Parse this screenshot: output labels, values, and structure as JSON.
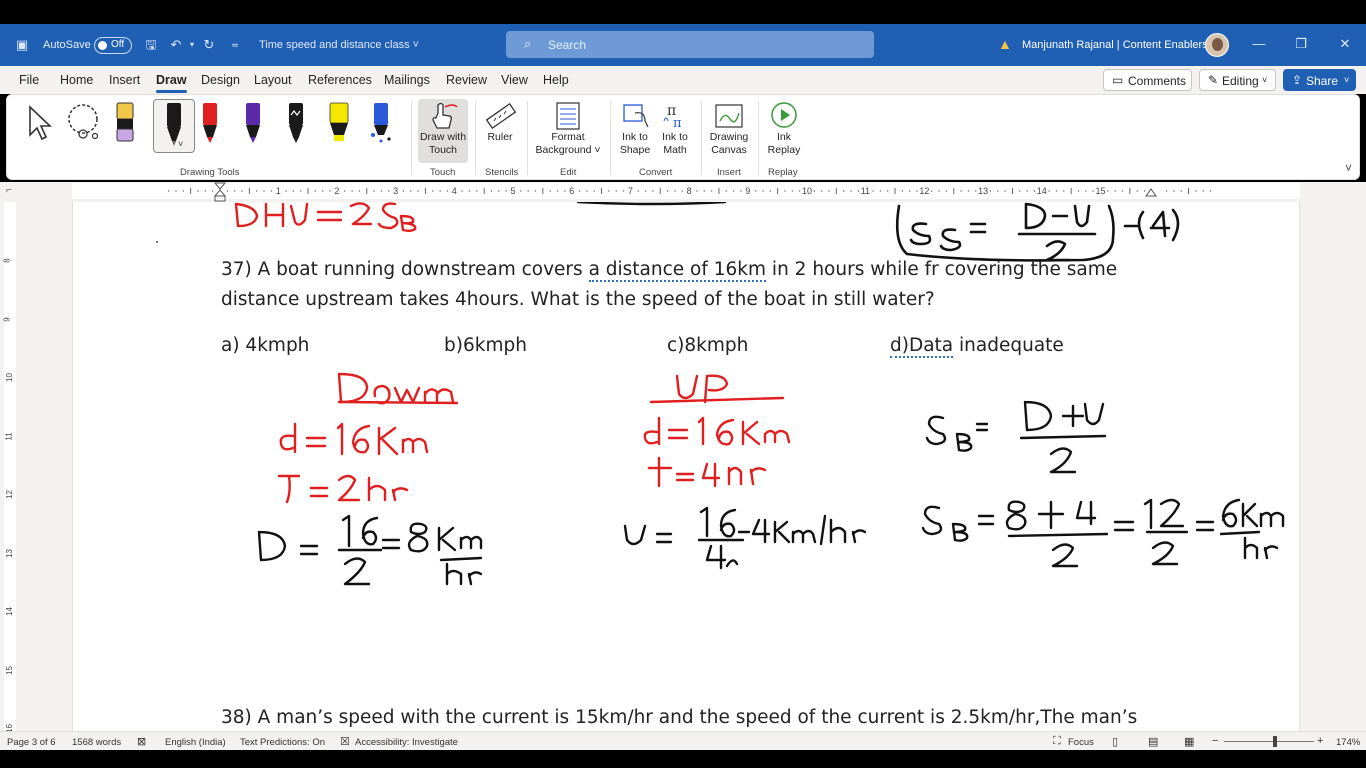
{
  "titlebar": {
    "autosave_label": "AutoSave",
    "autosave_state": "Off",
    "document_title": "Time speed and distance class",
    "search_placeholder": "Search",
    "user_name": "Manjunath Rajanal | Content Enablers"
  },
  "menu": {
    "tabs": [
      "File",
      "Home",
      "Insert",
      "Draw",
      "Design",
      "Layout",
      "References",
      "Mailings",
      "Review",
      "View",
      "Help"
    ],
    "active_tab": "Draw",
    "comments_label": "Comments",
    "editing_label": "Editing",
    "share_label": "Share"
  },
  "ribbon": {
    "groups": {
      "drawing_tools": "Drawing Tools",
      "touch": "Touch",
      "stencils": "Stencils",
      "edit": "Edit",
      "convert": "Convert",
      "insert": "Insert",
      "replay": "Replay"
    },
    "draw_with_touch": [
      "Draw with",
      "Touch"
    ],
    "ruler": "Ruler",
    "format_background": [
      "Format",
      "Background"
    ],
    "ink_to_shape": [
      "Ink to",
      "Shape"
    ],
    "ink_to_math": [
      "Ink to",
      "Math"
    ],
    "drawing_canvas": [
      "Drawing",
      "Canvas"
    ],
    "ink_replay": [
      "Ink",
      "Replay"
    ],
    "pen_colors": [
      "#e8e0c8",
      "#1a1a1a",
      "#e02020",
      "#5a2aa8",
      "#1a1a1a",
      "#f5e800",
      "#2a5ad8"
    ]
  },
  "ruler": {
    "numbers": [
      "1",
      "2",
      "3",
      "4",
      "5",
      "6",
      "7",
      "8",
      "9",
      "10",
      "11",
      "12",
      "13",
      "14",
      "15"
    ],
    "vertical_numbers": [
      "8",
      "9",
      "10",
      "11",
      "12",
      "13",
      "14",
      "15",
      "16"
    ]
  },
  "document": {
    "q37_line1_a": "37) A boat running downstream covers ",
    "q37_line1_b": "a distance of 16km",
    "q37_line1_c": " in 2 hours while fr covering the same",
    "q37_line2": "distance upstream takes 4hours. What is the speed of the boat in still water?",
    "opt_a": "a) 4kmph",
    "opt_b": "b)6kmph",
    "opt_c": "c)8kmph",
    "opt_d_a": "d)Data",
    "opt_d_b": " inadequate",
    "q38_line": "38) A man’s speed with the current is 15km/hr and the speed of the current is 2.5km/hr,The man’s",
    "ink": {
      "top_left": "DHU = 2SB",
      "top_right": "SS = D−U / 2 − (4)",
      "down_title": "Down",
      "down_d": "d = 16 km",
      "down_t": "T = 2hr",
      "down_calc": "D = 16/2 = 8 km/hr",
      "up_title": "UP",
      "up_d": "d = 16km",
      "up_t": "t = 4hr",
      "up_calc": "U = 16/4 = 4km/hr",
      "sb_formula": "SB = D+U / 2",
      "sb_calc": "SB = 8+4/2 = 12/2 = 6 km/hr"
    }
  },
  "status": {
    "page": "Page 3 of 6",
    "words": "1568 words",
    "language": "English (India)",
    "predictions": "Text Predictions: On",
    "accessibility": "Accessibility: Investigate",
    "focus": "Focus",
    "zoom": "174%"
  }
}
